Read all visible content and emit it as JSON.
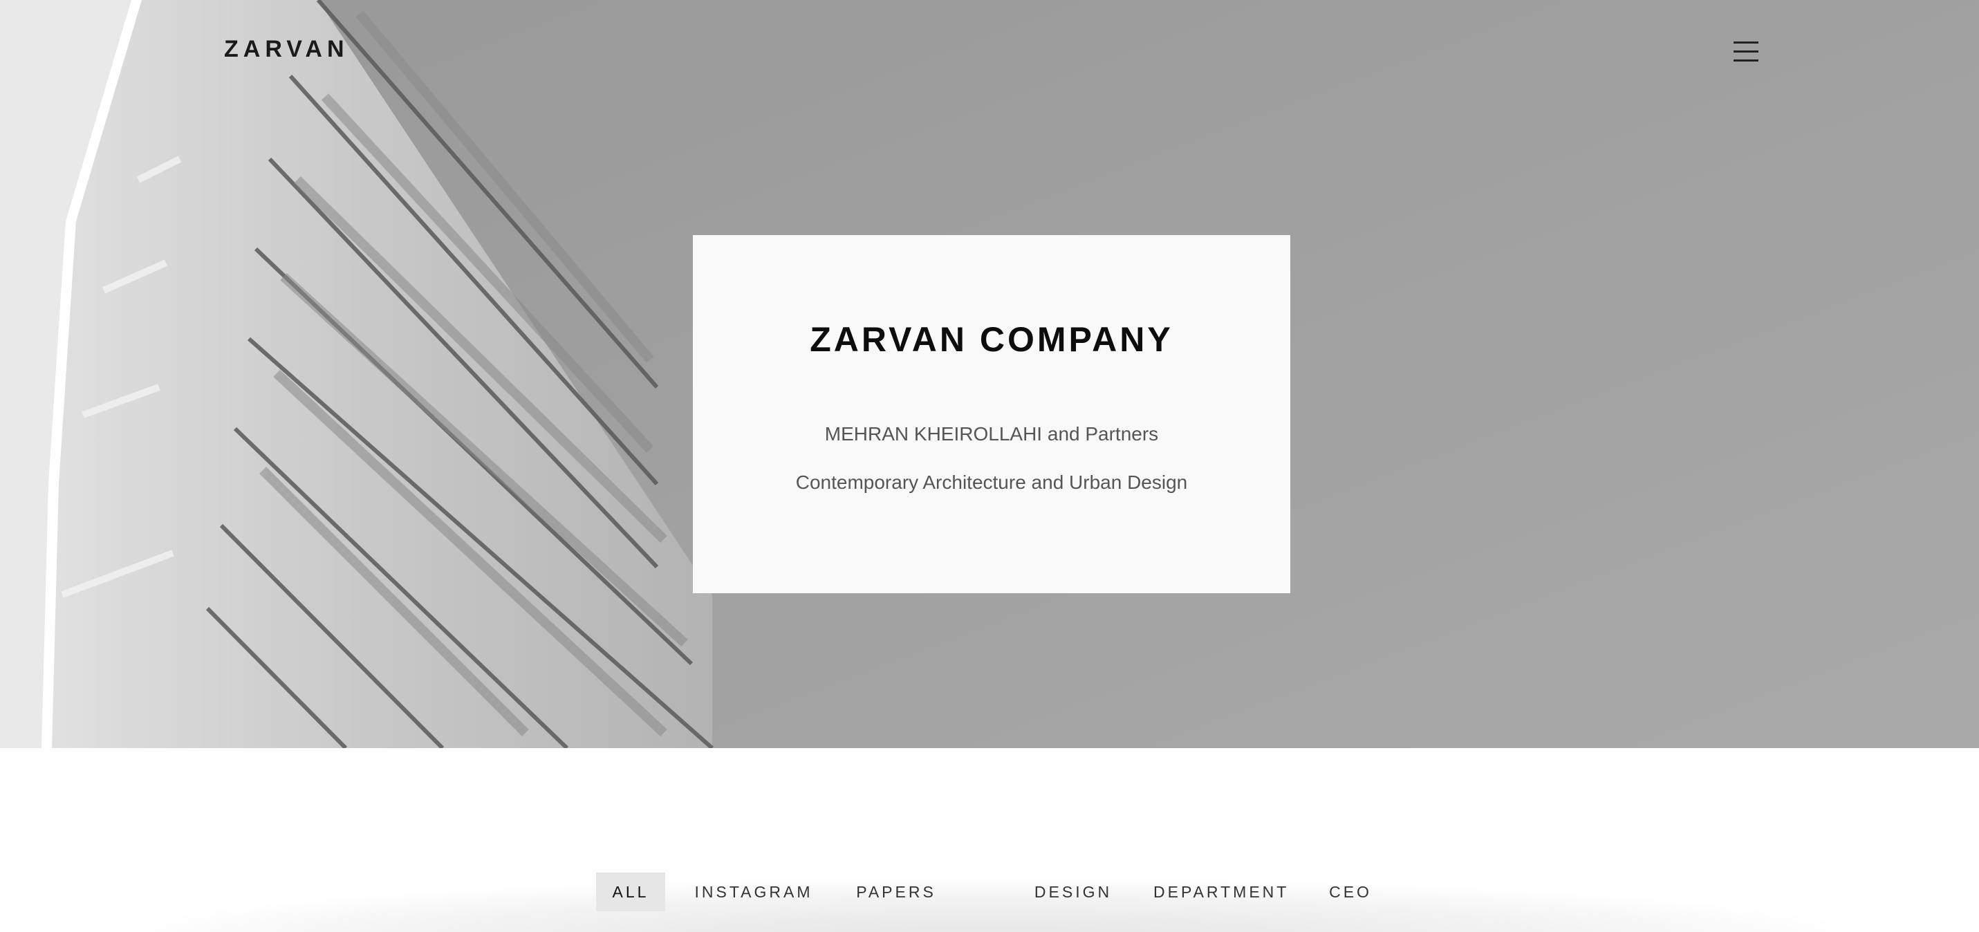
{
  "header": {
    "brand": "ZARVAN",
    "menu_icon": "hamburger-menu-icon"
  },
  "hero": {
    "image": "building-facade-photo",
    "card": {
      "title": "ZARVAN COMPANY",
      "subtitle": "MEHRAN KHEIROLLAHI and Partners",
      "tagline": "Contemporary Architecture and Urban Design"
    }
  },
  "filters": {
    "active": "ALL",
    "items": [
      {
        "label": "ALL"
      },
      {
        "label": "INSTAGRAM"
      },
      {
        "label": "PAPERS"
      },
      {
        "label": "DESIGN"
      },
      {
        "label": "DEPARTMENT"
      },
      {
        "label": "CEO"
      }
    ]
  },
  "colors": {
    "sky": "#a0a0a0",
    "card": "#f9f9f9",
    "active_filter_bg": "#e6e6e6"
  }
}
